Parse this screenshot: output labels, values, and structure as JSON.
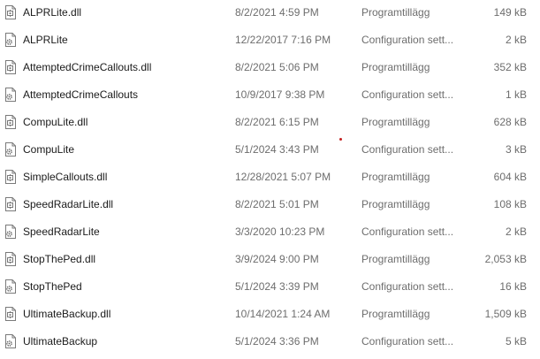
{
  "files": [
    {
      "name": "ALPRLite.dll",
      "date": "8/2/2021 4:59 PM",
      "type": "Programtillägg",
      "size": "149 kB",
      "icon": "dll-file-icon"
    },
    {
      "name": "ALPRLite",
      "date": "12/22/2017 7:16 PM",
      "type": "Configuration sett...",
      "size": "2 kB",
      "icon": "config-file-icon"
    },
    {
      "name": "AttemptedCrimeCallouts.dll",
      "date": "8/2/2021 5:06 PM",
      "type": "Programtillägg",
      "size": "352 kB",
      "icon": "dll-file-icon"
    },
    {
      "name": "AttemptedCrimeCallouts",
      "date": "10/9/2017 9:38 PM",
      "type": "Configuration sett...",
      "size": "1 kB",
      "icon": "config-file-icon"
    },
    {
      "name": "CompuLite.dll",
      "date": "8/2/2021 6:15 PM",
      "type": "Programtillägg",
      "size": "628 kB",
      "icon": "dll-file-icon"
    },
    {
      "name": "CompuLite",
      "date": "5/1/2024 3:43 PM",
      "type": "Configuration sett...",
      "size": "3 kB",
      "icon": "config-file-icon"
    },
    {
      "name": "SimpleCallouts.dll",
      "date": "12/28/2021 5:07 PM",
      "type": "Programtillägg",
      "size": "604 kB",
      "icon": "dll-file-icon"
    },
    {
      "name": "SpeedRadarLite.dll",
      "date": "8/2/2021 5:01 PM",
      "type": "Programtillägg",
      "size": "108 kB",
      "icon": "dll-file-icon"
    },
    {
      "name": "SpeedRadarLite",
      "date": "3/3/2020 10:23 PM",
      "type": "Configuration sett...",
      "size": "2 kB",
      "icon": "config-file-icon"
    },
    {
      "name": "StopThePed.dll",
      "date": "3/9/2024 9:00 PM",
      "type": "Programtillägg",
      "size": "2,053 kB",
      "icon": "dll-file-icon"
    },
    {
      "name": "StopThePed",
      "date": "5/1/2024 3:39 PM",
      "type": "Configuration sett...",
      "size": "16 kB",
      "icon": "config-file-icon"
    },
    {
      "name": "UltimateBackup.dll",
      "date": "10/14/2021 1:24 AM",
      "type": "Programtillägg",
      "size": "1,509 kB",
      "icon": "dll-file-icon"
    },
    {
      "name": "UltimateBackup",
      "date": "5/1/2024 3:36 PM",
      "type": "Configuration sett...",
      "size": "5 kB",
      "icon": "config-file-icon"
    }
  ],
  "colors": {
    "name_text": "#1a1a1a",
    "meta_text": "#6d6d6d",
    "background": "#ffffff",
    "marker_dot": "#c41f1f"
  }
}
